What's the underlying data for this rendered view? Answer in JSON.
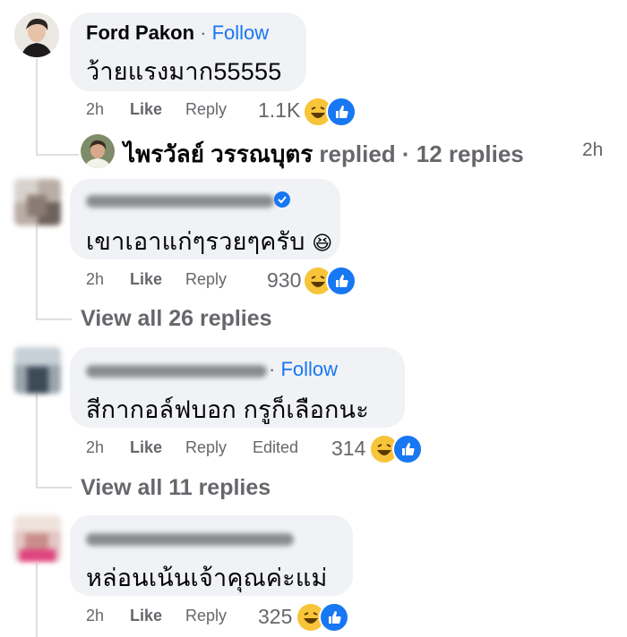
{
  "comments": [
    {
      "author": "Ford Pakon",
      "follow_label": "Follow",
      "text": "ว้ายแรงมาก55555",
      "time": "2h",
      "like_label": "Like",
      "reply_label": "Reply",
      "reaction_count": "1.1K",
      "reply_summary": {
        "author": "ไพรวัลย์ วรรณบุตร",
        "action": "replied",
        "count_label": "· 12 replies",
        "time": "2h"
      }
    },
    {
      "text": "เขาเอาแก่ๆรวยๆครับ",
      "emoji": "😆",
      "time": "2h",
      "like_label": "Like",
      "reply_label": "Reply",
      "reaction_count": "930",
      "view_replies": "View all 26 replies"
    },
    {
      "follow_label": "Follow",
      "text": "สีกากอล์ฟบอก กรูก็เลือกนะ",
      "time": "2h",
      "like_label": "Like",
      "reply_label": "Reply",
      "edited_label": "Edited",
      "reaction_count": "314",
      "view_replies": "View all 11 replies"
    },
    {
      "text": "หล่อนเน้นเจ้าคุณค่ะแม่",
      "time": "2h",
      "like_label": "Like",
      "reply_label": "Reply",
      "reaction_count": "325"
    }
  ],
  "colors": {
    "bubble": "#f0f2f5",
    "follow": "#1877f2",
    "meta": "#65676b",
    "haha": "#f7c43a",
    "like": "#1877f2"
  }
}
